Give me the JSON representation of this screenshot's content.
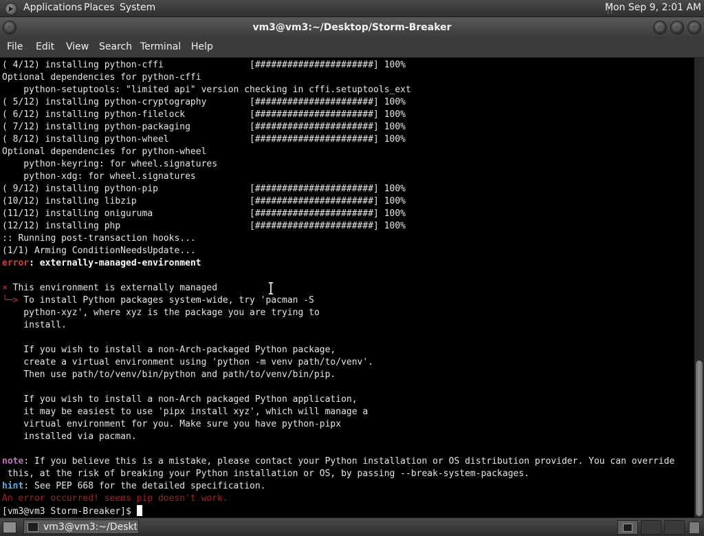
{
  "top_panel": {
    "applications": "Applications",
    "places": "Places",
    "system": "System",
    "clock": "Mon Sep  9,  2:01 AM"
  },
  "window": {
    "title": "vm3@vm3:~/Desktop/Storm-Breaker",
    "menu": [
      "File",
      "Edit",
      "View",
      "Search",
      "Terminal",
      "Help"
    ]
  },
  "terminal": {
    "lines": [
      {
        "text": "( 4/12) installing python-cffi                [######################] 100%"
      },
      {
        "text": "Optional dependencies for python-cffi"
      },
      {
        "text": "    python-setuptools: \"limited api\" version checking in cffi.setuptools_ext"
      },
      {
        "text": "( 5/12) installing python-cryptography        [######################] 100%"
      },
      {
        "text": "( 6/12) installing python-filelock            [######################] 100%"
      },
      {
        "text": "( 7/12) installing python-packaging           [######################] 100%"
      },
      {
        "text": "( 8/12) installing python-wheel               [######################] 100%"
      },
      {
        "text": "Optional dependencies for python-wheel"
      },
      {
        "text": "    python-keyring: for wheel.signatures"
      },
      {
        "text": "    python-xdg: for wheel.signatures"
      },
      {
        "text": "( 9/12) installing python-pip                 [######################] 100%"
      },
      {
        "text": "(10/12) installing libzip                     [######################] 100%"
      },
      {
        "text": "(11/12) installing oniguruma                  [######################] 100%"
      },
      {
        "text": "(12/12) installing php                        [######################] 100%"
      },
      {
        "text": ":: Running post-transaction hooks..."
      },
      {
        "text": "(1/1) Arming ConditionNeedsUpdate..."
      },
      {
        "prefix": "error",
        "text": ": externally-managed-environment",
        "style": "error"
      },
      {
        "text": ""
      },
      {
        "bullet": "×",
        "text": " This environment is externally managed"
      },
      {
        "bullet": "╰─>",
        "text": " To install Python packages system-wide, try 'pacman -S"
      },
      {
        "text": "    python-xyz', where xyz is the package you are trying to"
      },
      {
        "text": "    install."
      },
      {
        "text": ""
      },
      {
        "text": "    If you wish to install a non-Arch-packaged Python package,"
      },
      {
        "text": "    create a virtual environment using 'python -m venv path/to/venv'."
      },
      {
        "text": "    Then use path/to/venv/bin/python and path/to/venv/bin/pip."
      },
      {
        "text": ""
      },
      {
        "text": "    If you wish to install a non-Arch packaged Python application,"
      },
      {
        "text": "    it may be easiest to use 'pipx install xyz', which will manage a"
      },
      {
        "text": "    virtual environment for you. Make sure you have python-pipx"
      },
      {
        "text": "    installed via pacman."
      },
      {
        "text": ""
      },
      {
        "prefix": "note",
        "text": ": If you believe this is a mistake, please contact your Python installation or OS distribution provider. You can override",
        "style": "note"
      },
      {
        "text": " this, at the risk of breaking your Python installation or OS, by passing --break-system-packages."
      },
      {
        "prefix": "hint",
        "text": ": See PEP 668 for the detailed specification.",
        "style": "hint"
      },
      {
        "text": "An error occurred! seems pip doesn't work.",
        "style": "dimred"
      },
      {
        "text": "[vm3@vm3 Storm-Breaker]$ ",
        "style": "prompt"
      }
    ]
  },
  "bottom_panel": {
    "task_label": "vm3@vm3:~/Deskt..."
  }
}
